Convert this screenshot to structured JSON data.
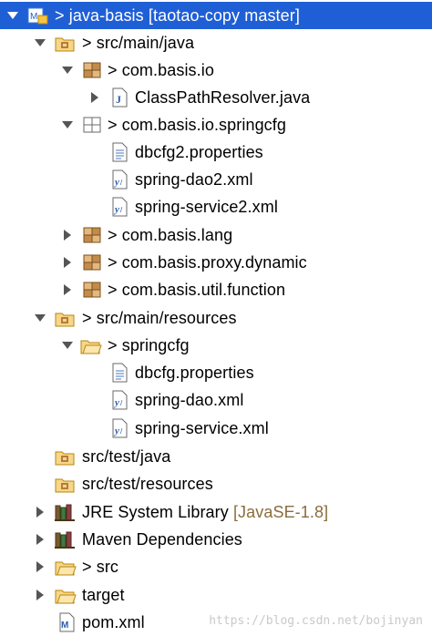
{
  "tree": {
    "project": {
      "prefix": "> ",
      "label": "java-basis",
      "decoration": "[taotao-copy master]",
      "icon": "maven-project-icon"
    },
    "items": [
      {
        "prefix": "> ",
        "label": "src/main/java",
        "icon": "source-folder-icon"
      },
      {
        "prefix": "> ",
        "label": "com.basis.io",
        "icon": "package-icon"
      },
      {
        "prefix": "",
        "label": "ClassPathResolver.java",
        "icon": "java-file-icon"
      },
      {
        "prefix": "> ",
        "label": "com.basis.io.springcfg",
        "icon": "package-empty-icon"
      },
      {
        "prefix": "",
        "label": "dbcfg2.properties",
        "icon": "properties-file-icon"
      },
      {
        "prefix": "",
        "label": "spring-dao2.xml",
        "icon": "xml-file-icon"
      },
      {
        "prefix": "",
        "label": "spring-service2.xml",
        "icon": "xml-file-icon"
      },
      {
        "prefix": "> ",
        "label": "com.basis.lang",
        "icon": "package-icon"
      },
      {
        "prefix": "> ",
        "label": "com.basis.proxy.dynamic",
        "icon": "package-icon"
      },
      {
        "prefix": "> ",
        "label": "com.basis.util.function",
        "icon": "package-icon"
      },
      {
        "prefix": "> ",
        "label": "src/main/resources",
        "icon": "source-folder-icon"
      },
      {
        "prefix": "> ",
        "label": "springcfg",
        "icon": "folder-icon"
      },
      {
        "prefix": "",
        "label": "dbcfg.properties",
        "icon": "properties-file-icon"
      },
      {
        "prefix": "",
        "label": "spring-dao.xml",
        "icon": "xml-file-icon"
      },
      {
        "prefix": "",
        "label": "spring-service.xml",
        "icon": "xml-file-icon"
      },
      {
        "prefix": "",
        "label": "src/test/java",
        "icon": "source-folder-icon"
      },
      {
        "prefix": "",
        "label": "src/test/resources",
        "icon": "source-folder-icon"
      },
      {
        "prefix": "",
        "label": "JRE System Library",
        "decoration": "[JavaSE-1.8]",
        "icon": "library-icon"
      },
      {
        "prefix": "",
        "label": "Maven Dependencies",
        "icon": "library-icon"
      },
      {
        "prefix": "> ",
        "label": "src",
        "icon": "folder-icon"
      },
      {
        "prefix": "",
        "label": "target",
        "icon": "folder-icon"
      },
      {
        "prefix": "",
        "label": "pom.xml",
        "icon": "pom-file-icon"
      }
    ]
  },
  "watermark": "https://blog.csdn.net/bojinyan",
  "colors": {
    "selection": "#1f5fd6",
    "decoration": "#8a6d3b",
    "watermark": "#c9c9c9"
  }
}
